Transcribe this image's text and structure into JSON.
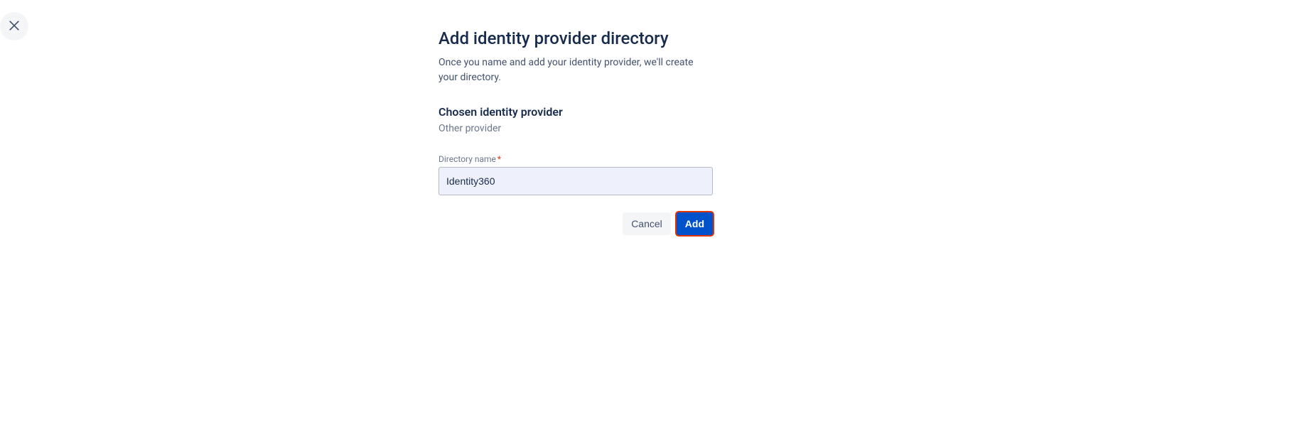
{
  "header": {
    "title": "Add identity provider directory",
    "subtitle": "Once you name and add your identity provider, we'll create your directory."
  },
  "section": {
    "chosen_label": "Chosen identity provider",
    "provider_value": "Other provider"
  },
  "form": {
    "directory_name_label": "Directory name",
    "directory_name_value": "Identity360"
  },
  "buttons": {
    "cancel": "Cancel",
    "add": "Add"
  }
}
